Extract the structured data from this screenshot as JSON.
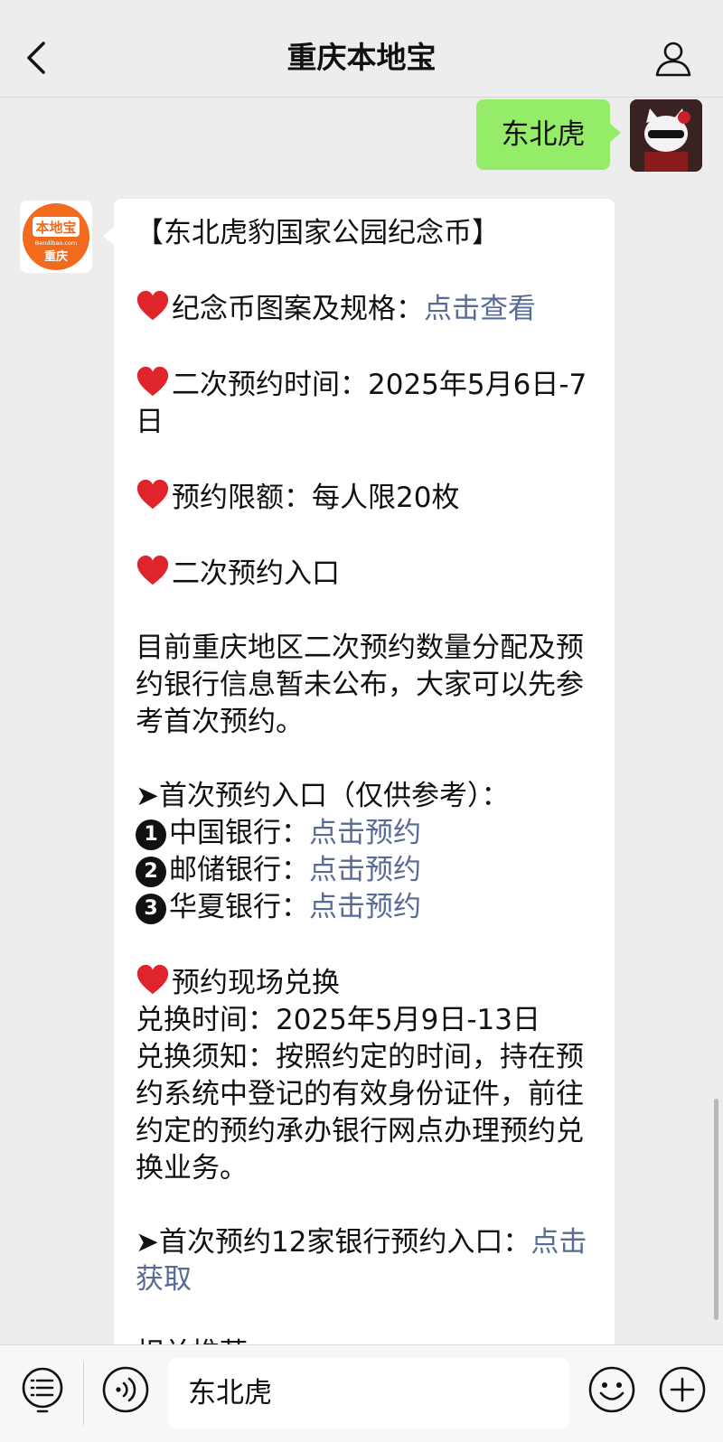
{
  "header": {
    "title": "重庆本地宝"
  },
  "chat": {
    "user_message": "东北虎",
    "bot_avatar": {
      "logo_text": "本地宝",
      "domain_text": "Bendibao.com",
      "city_text": "重庆"
    },
    "bot_message": {
      "title": "【东北虎豹国家公园纪念币】",
      "pattern_label": "纪念币图案及规格：",
      "pattern_link": "点击查看",
      "second_time_label": "二次预约时间：",
      "second_time_value": "2025年5月6日-7日",
      "limit_label": "预约限额：",
      "limit_value": "每人限20枚",
      "second_entry": "二次预约入口",
      "info_paragraph": "目前重庆地区二次预约数量分配及预约银行信息暂未公布，大家可以先参考首次预约。",
      "first_entry_heading": "➤首次预约入口（仅供参考）：",
      "banks": [
        {
          "num": "1",
          "name": "中国银行：",
          "link": "点击预约"
        },
        {
          "num": "2",
          "name": "邮储银行：",
          "link": "点击预约"
        },
        {
          "num": "3",
          "name": "华夏银行：",
          "link": "点击预约"
        }
      ],
      "exchange_heading": "预约现场兑换",
      "exchange_time": "兑换时间：2025年5月9日-13日",
      "exchange_notice": "兑换须知：按照约定的时间，持在预约系统中登记的有效身份证件，前往约定的预约承办银行网点办理预约兑换业务。",
      "twelve_banks_label": "➤首次预约12家银行预约入口：",
      "twelve_banks_link": "点击获取",
      "related": "相关推荐："
    }
  },
  "input_bar": {
    "value": "东北虎"
  },
  "colors": {
    "background": "#ededed",
    "user_bubble": "#95ec69",
    "link": "#576b95",
    "heart": "#e0242b",
    "logo_orange": "#f26b1d"
  }
}
